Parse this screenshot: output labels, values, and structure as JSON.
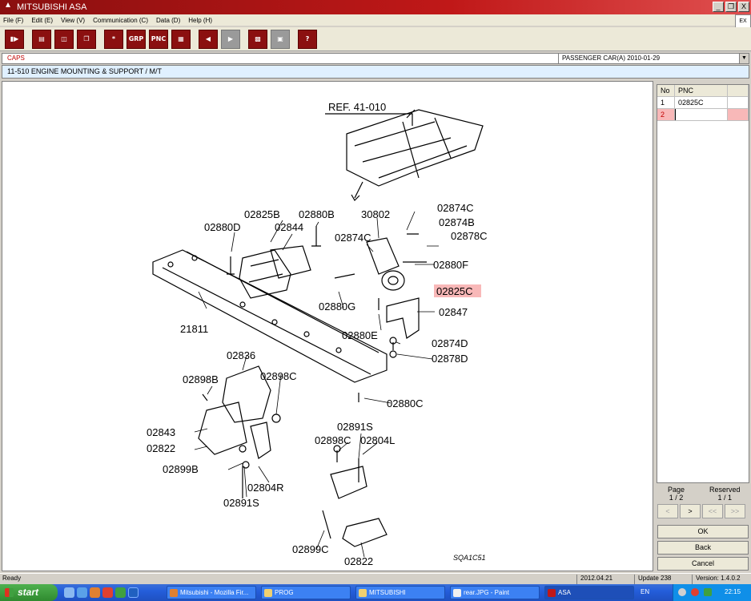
{
  "window": {
    "title": "MITSUBISHI ASA",
    "minimize": "_",
    "restore": "❐",
    "close": "X"
  },
  "menu": [
    "File (F)",
    "Edit (E)",
    "View (V)",
    "Communication (C)",
    "Data (D)",
    "Help (H)"
  ],
  "ex_logo": "EX",
  "toolbar": {
    "btn_grp": "GRP",
    "btn_pnc": "PNC",
    "btn_help": "?",
    "btn_star": "*"
  },
  "caps": {
    "label": "CAPS",
    "car": "PASSENGER CAR(A)   2010-01-29"
  },
  "group": {
    "title": "11-510  ENGINE MOUNTING & SUPPORT / M/T"
  },
  "drawing": {
    "ref": "REF. 41-010",
    "code": "SQA1C51",
    "labels": {
      "l02825B": "02825B",
      "l02880B": "02880B",
      "l30802": "30802",
      "l02874C_a": "02874C",
      "l02874B": "02874B",
      "l02880D": "02880D",
      "l02844": "02844",
      "l02874C_b": "02874C",
      "l02878C": "02878C",
      "l02880F": "02880F",
      "l02825C": "02825C",
      "l02880G": "02880G",
      "l02847": "02847",
      "l21811": "21811",
      "l02880E": "02880E",
      "l02874D": "02874D",
      "l02836": "02836",
      "l02878D": "02878D",
      "l02898B": "02898B",
      "l02898C_a": "02898C",
      "l02880C": "02880C",
      "l02891S_a": "02891S",
      "l02843": "02843",
      "l02898C_b": "02898C",
      "l02804L": "02804L",
      "l02822_a": "02822",
      "l02899B": "02899B",
      "l02804R": "02804R",
      "l02891S_b": "02891S",
      "l02899C": "02899C",
      "l02822_b": "02822"
    }
  },
  "pnc_table": {
    "headers": {
      "no": "No",
      "pnc": "PNC"
    },
    "rows": [
      {
        "no": "1",
        "pnc": "02825C"
      },
      {
        "no": "2",
        "pnc": ""
      }
    ]
  },
  "page": {
    "label": "Page",
    "value": "1 / 2",
    "reserved_label": "Reserved",
    "reserved_value": "1 / 1"
  },
  "nav": {
    "prev": "<",
    "next": ">",
    "first": "<<",
    "last": ">>"
  },
  "buttons": {
    "ok": "OK",
    "back": "Back",
    "cancel": "Cancel"
  },
  "status": {
    "text": "Ready",
    "date": "2012.04.21",
    "update": "Update 238",
    "version": "Version: 1.4.0.2"
  },
  "taskbar": {
    "start": "start",
    "tasks": [
      "Mitsubishi - Mozilla Fir...",
      "PROG",
      "MITSUBISHI",
      "rear.JPG - Paint",
      "ASA"
    ],
    "lang": "EN",
    "clock": "22:15"
  },
  "colors": {
    "accent": "#8b1010",
    "highlight": "#f8b8b8",
    "title": "#c01818"
  }
}
